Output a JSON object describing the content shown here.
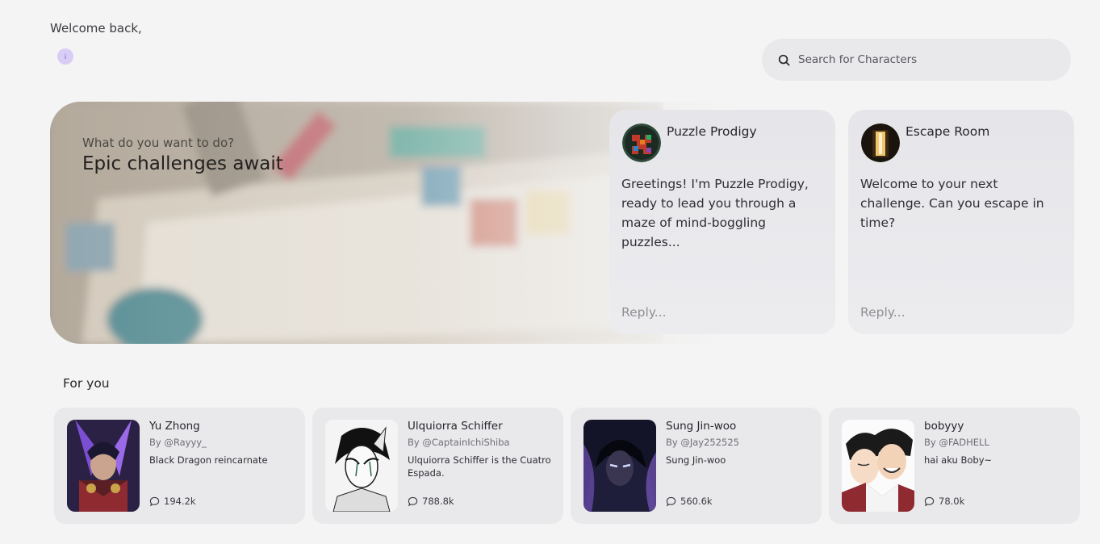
{
  "header": {
    "welcome_text": "Welcome back,",
    "avatar_letter": "i"
  },
  "search": {
    "placeholder": "Search for Characters",
    "value": ""
  },
  "hero": {
    "eyebrow": "What do you want to do?",
    "title": "Epic challenges await"
  },
  "featured_characters": [
    {
      "name": "Puzzle Prodigy",
      "message": "Greetings! I'm Puzzle Prodigy, ready to lead you through a maze of mind-boggling puzzles...",
      "reply_placeholder": "Reply..."
    },
    {
      "name": "Escape Room",
      "message": "Welcome to your next challenge. Can you escape in time?",
      "reply_placeholder": "Reply..."
    }
  ],
  "for_you": {
    "title": "For you",
    "items": [
      {
        "name": "Yu Zhong",
        "author": "By @Rayyy_",
        "description": "Black Dragon reincarnate",
        "chats": "194.2k"
      },
      {
        "name": "Ulquiorra Schiffer",
        "author": "By @CaptainIchiShiba",
        "description": "Ulquiorra Schiffer is the Cuatro Espada.",
        "chats": "788.8k"
      },
      {
        "name": "Sung Jin-woo",
        "author": "By @Jay252525",
        "description": "Sung Jin-woo",
        "chats": "560.6k"
      },
      {
        "name": "bobyyy",
        "author": "By @FADHELL",
        "description": "hai aku Boby~",
        "chats": "78.0k"
      }
    ]
  },
  "icons": {
    "search": "search-icon",
    "chat": "chat-bubble-icon"
  },
  "colors": {
    "background": "#f4f4f4",
    "card": "#e9e9ec",
    "avatar_accent": "#d9cdf6"
  }
}
